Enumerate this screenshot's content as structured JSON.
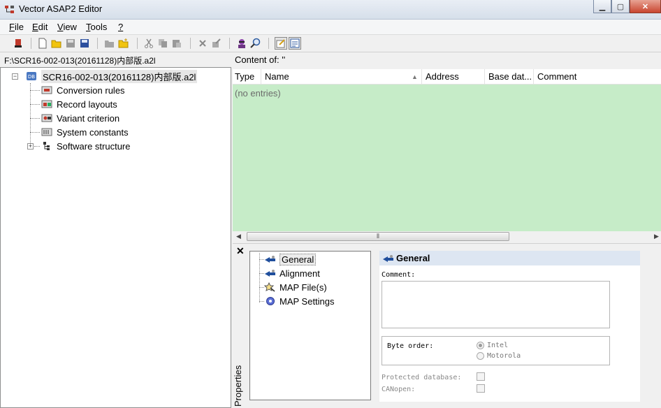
{
  "window": {
    "title": "Vector ASAP2 Editor"
  },
  "menu": [
    {
      "label": "File",
      "accel": "F"
    },
    {
      "label": "Edit",
      "accel": "E"
    },
    {
      "label": "View",
      "accel": "V"
    },
    {
      "label": "Tools",
      "accel": "T"
    },
    {
      "label": "?",
      "accel": "?"
    }
  ],
  "toolbar": {
    "icons": [
      "exit-icon",
      "new-file-icon",
      "open-folder-icon",
      "save-icon",
      "save-as-icon",
      "import-icon",
      "new-folder-icon",
      "cut-icon",
      "copy-icon",
      "paste-icon",
      "delete-icon",
      "properties-icon",
      "user-icon",
      "search-icon",
      "edit-icon",
      "notepad-icon"
    ]
  },
  "left": {
    "path": "F:\\SCR16-002-013(20161128)内部版.a2l",
    "root": "SCR16-002-013(20161128)内部版.a2l",
    "items": [
      {
        "label": "Conversion rules",
        "icon": "conversion-rules-icon"
      },
      {
        "label": "Record layouts",
        "icon": "record-layouts-icon"
      },
      {
        "label": "Variant criterion",
        "icon": "variant-criterion-icon"
      },
      {
        "label": "System constants",
        "icon": "system-constants-icon"
      },
      {
        "label": "Software structure",
        "icon": "software-structure-icon"
      }
    ]
  },
  "right": {
    "content_of": "Content of: ''",
    "columns": [
      "Type",
      "Name",
      "Address",
      "Base dat...",
      "Comment"
    ],
    "empty_text": "(no entries)"
  },
  "properties": {
    "close": "✕",
    "vertical_label": "Properties",
    "tree": [
      {
        "label": "General",
        "icon": "general-icon"
      },
      {
        "label": "Alignment",
        "icon": "alignment-icon"
      },
      {
        "label": "MAP File(s)",
        "icon": "map-files-icon"
      },
      {
        "label": "MAP Settings",
        "icon": "map-settings-icon"
      }
    ],
    "panel": {
      "title": "General",
      "comment_label": "Comment:",
      "comment_value": "",
      "byte_order_label": "Byte order:",
      "byte_order_options": [
        "Intel",
        "Motorola"
      ],
      "byte_order_selected": "Intel",
      "protected_label": "Protected database:",
      "canopen_label": "CANopen:"
    }
  },
  "colors": {
    "list_bg": "#c6ecc8",
    "header_bg": "#dde6f2",
    "close_btn": "#c8452f"
  }
}
